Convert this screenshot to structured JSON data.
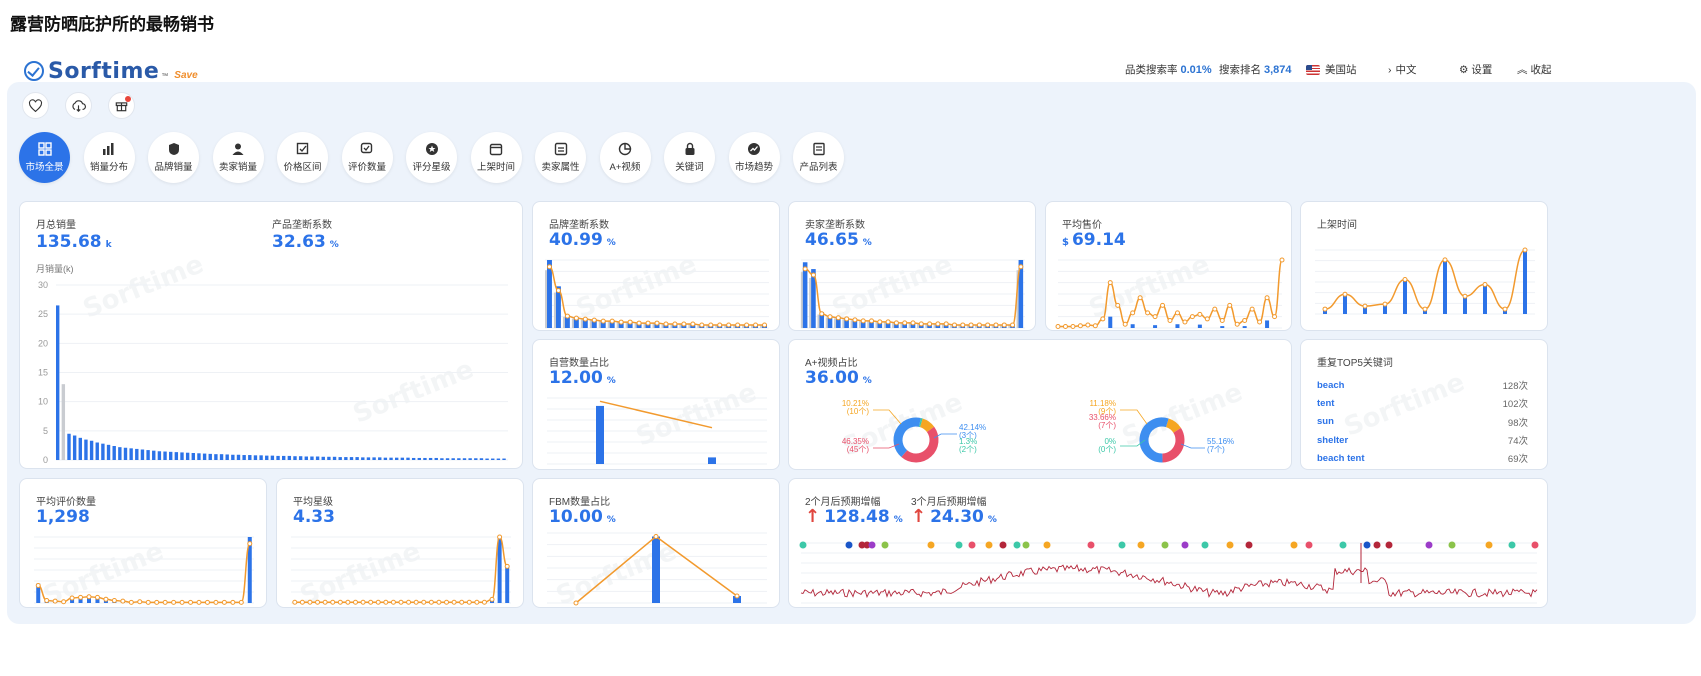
{
  "page_title": "露营防晒庇护所的最畅销书",
  "header": {
    "logo_text": "Sorftime",
    "logo_tm": "™",
    "logo_save": "Save",
    "cat_search_label": "品类搜索率",
    "cat_search_value": "0.01%",
    "search_rank_label": "搜索排名",
    "search_rank_value": "3,874",
    "site": "美国站",
    "lang": "中文",
    "settings": "设置",
    "collapse": "收起"
  },
  "top_icons": [
    "heart-icon",
    "cloud-download-icon",
    "gift-icon"
  ],
  "nav": [
    {
      "label": "市场全景",
      "icon": "grid-icon",
      "active": true
    },
    {
      "label": "销量分布",
      "icon": "bar-chart-icon"
    },
    {
      "label": "品牌销量",
      "icon": "brand-badge-icon"
    },
    {
      "label": "卖家销量",
      "icon": "seller-icon"
    },
    {
      "label": "价格区间",
      "icon": "price-edit-icon"
    },
    {
      "label": "评价数量",
      "icon": "review-icon"
    },
    {
      "label": "评分星级",
      "icon": "star-icon"
    },
    {
      "label": "上架时间",
      "icon": "calendar-icon"
    },
    {
      "label": "卖家属性",
      "icon": "seller-attr-icon"
    },
    {
      "label": "A+视频",
      "icon": "pie-icon"
    },
    {
      "label": "关键词",
      "icon": "lock-icon"
    },
    {
      "label": "市场趋势",
      "icon": "trend-icon"
    },
    {
      "label": "产品列表",
      "icon": "list-icon"
    }
  ],
  "watermark": "Sorftime",
  "cards": {
    "monthly_sales": {
      "label": "月总销量",
      "value": "135.68",
      "unit": "k",
      "axis_label": "月销量(k)"
    },
    "product_monopoly": {
      "label": "产品垄断系数",
      "value": "32.63",
      "unit": "%"
    },
    "brand_monopoly": {
      "label": "品牌垄断系数",
      "value": "40.99",
      "unit": "%"
    },
    "seller_monopoly": {
      "label": "卖家垄断系数",
      "value": "46.65",
      "unit": "%"
    },
    "avg_price": {
      "label": "平均售价",
      "currency": "$",
      "value": "69.14"
    },
    "listing_time": {
      "label": "上架时间"
    },
    "self_ship": {
      "label": "自营数量占比",
      "value": "12.00",
      "unit": "%"
    },
    "aplus": {
      "label": "A+视频占比",
      "value": "36.00",
      "unit": "%"
    },
    "top5": {
      "label": "重复TOP5关键词"
    },
    "avg_reviews": {
      "label": "平均评价数量",
      "value": "1,298"
    },
    "avg_rating": {
      "label": "平均星级",
      "value": "4.33"
    },
    "fbm": {
      "label": "FBM数量占比",
      "value": "10.00",
      "unit": "%"
    },
    "growth": {
      "label2": "2个月后预期增幅",
      "value2": "128.48",
      "unit2": "%",
      "label3": "3个月后预期增幅",
      "value3": "24.30",
      "unit3": "%"
    }
  },
  "donut_labels": {
    "left": [
      {
        "pct": "10.21%",
        "cnt": "(10个)",
        "color": "#f5a623"
      },
      {
        "pct": "46.35%",
        "cnt": "(45个)",
        "color": "#e8506a"
      },
      {
        "pct": "42.14%",
        "cnt": "(3个)",
        "color": "#3d8ef0"
      },
      {
        "pct": "1.3%",
        "cnt": "(2个)",
        "color": "#3cc8a8"
      }
    ],
    "right": [
      {
        "pct": "11.18%",
        "cnt": "(9个)",
        "color": "#f5a623"
      },
      {
        "pct": "33.66%",
        "cnt": "(7个)",
        "color": "#e8506a"
      },
      {
        "pct": "0%",
        "cnt": "(0个)",
        "color": "#3cc8a8"
      },
      {
        "pct": "55.16%",
        "cnt": "(7个)",
        "color": "#3d8ef0"
      }
    ]
  },
  "keywords": [
    {
      "k": "beach",
      "c": "128次"
    },
    {
      "k": "tent",
      "c": "102次"
    },
    {
      "k": "sun",
      "c": "98次"
    },
    {
      "k": "shelter",
      "c": "74次"
    },
    {
      "k": "beach tent",
      "c": "69次"
    }
  ],
  "chart_data": [
    {
      "type": "bar",
      "id": "monthly_sales",
      "ylabel": "月销量(k)",
      "ylim": [
        0,
        30
      ],
      "yticks": [
        0,
        5,
        10,
        15,
        20,
        25,
        30
      ],
      "values": [
        26.5,
        13,
        4.5,
        4.2,
        3.8,
        3.5,
        3.3,
        3.0,
        2.8,
        2.6,
        2.4,
        2.2,
        2.1,
        2.0,
        1.9,
        1.8,
        1.7,
        1.6,
        1.5,
        1.45,
        1.4,
        1.35,
        1.3,
        1.25,
        1.2,
        1.15,
        1.1,
        1.05,
        1.0,
        1.0,
        0.95,
        0.9,
        0.9,
        0.85,
        0.85,
        0.8,
        0.8,
        0.75,
        0.75,
        0.7,
        0.7,
        0.7,
        0.65,
        0.65,
        0.6,
        0.6,
        0.6,
        0.55,
        0.55,
        0.55,
        0.5,
        0.5,
        0.5,
        0.5,
        0.45,
        0.45,
        0.45,
        0.45,
        0.4,
        0.4,
        0.4,
        0.4,
        0.4,
        0.35,
        0.35,
        0.35,
        0.35,
        0.35,
        0.3,
        0.3,
        0.3,
        0.3,
        0.3,
        0.3,
        0.3,
        0.3,
        0.25,
        0.25,
        0.25,
        0.25
      ]
    },
    {
      "type": "bar",
      "id": "brand_monopoly",
      "values": [
        62,
        38,
        12,
        10,
        9,
        8,
        7,
        7,
        6,
        6,
        5,
        5,
        5,
        4,
        4,
        4,
        4,
        3,
        3,
        3,
        3,
        3,
        3,
        3,
        3
      ]
    },
    {
      "type": "bar",
      "id": "seller_monopoly",
      "values": [
        58,
        52,
        14,
        11,
        10,
        9,
        8,
        7,
        7,
        6,
        6,
        5,
        5,
        5,
        4,
        4,
        4,
        4,
        3,
        3,
        3,
        3,
        3,
        3,
        3,
        3,
        60
      ]
    },
    {
      "type": "line",
      "id": "avg_price",
      "values": [
        2,
        2,
        2,
        3,
        4,
        3,
        12,
        60,
        30,
        5,
        20,
        40,
        20,
        15,
        30,
        10,
        20,
        8,
        15,
        18,
        12,
        25,
        10,
        30,
        5,
        10,
        25,
        8,
        40,
        15,
        90
      ]
    },
    {
      "type": "bar",
      "id": "listing_time",
      "values": [
        5,
        20,
        8,
        10,
        35,
        5,
        55,
        18,
        30,
        5,
        65
      ]
    },
    {
      "type": "bar",
      "id": "self_ship",
      "values": [
        88,
        10
      ]
    },
    {
      "type": "bar",
      "id": "avg_reviews",
      "values": [
        28,
        4,
        3,
        2,
        8,
        9,
        10,
        9,
        6,
        4,
        3,
        1,
        2,
        1,
        1,
        1,
        1,
        1,
        1,
        1,
        1,
        1,
        1,
        1,
        1,
        95
      ]
    },
    {
      "type": "bar",
      "id": "avg_rating",
      "values": [
        1,
        1,
        1,
        1,
        1,
        1,
        1,
        1,
        1,
        1,
        1,
        1,
        1,
        1,
        1,
        1,
        1,
        1,
        1,
        1,
        1,
        1,
        1,
        1,
        1,
        1,
        5,
        90,
        50
      ]
    },
    {
      "type": "bar",
      "id": "fbm",
      "values": [
        0,
        95,
        10
      ]
    },
    {
      "type": "pie",
      "id": "aplus_left",
      "values": [
        10.21,
        46.35,
        42.14,
        1.3
      ]
    },
    {
      "type": "pie",
      "id": "aplus_right",
      "values": [
        11.18,
        33.66,
        0,
        55.16
      ]
    }
  ]
}
